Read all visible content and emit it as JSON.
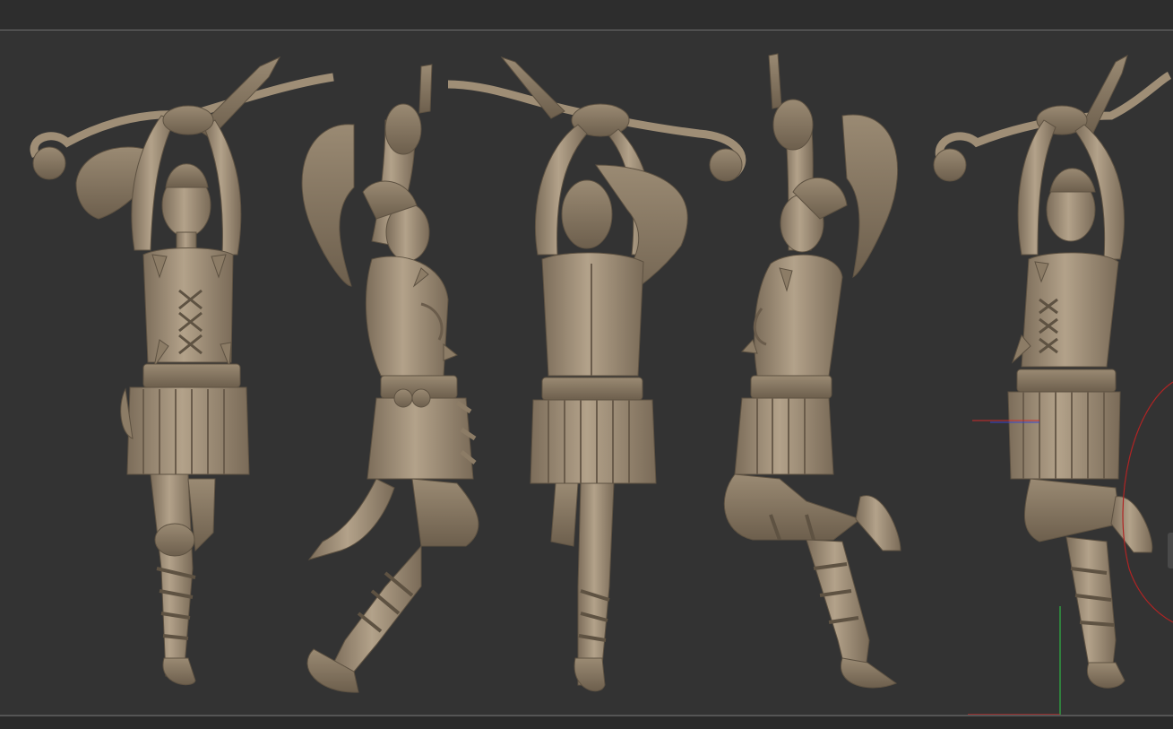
{
  "app": {
    "title": "",
    "viewport_mode": "3d-sculpt-viewport"
  },
  "viewport": {
    "background_color": "#333333",
    "material_color": "#a8977f",
    "material_shadow_color": "#6e604f",
    "axis_colors": {
      "x": "#cc2b2b",
      "y": "#2fb344",
      "z": "#3a46c9"
    },
    "views": [
      {
        "name": "front",
        "icon": "figure-front-icon"
      },
      {
        "name": "left-side",
        "icon": "figure-side-icon"
      },
      {
        "name": "back",
        "icon": "figure-back-icon"
      },
      {
        "name": "right-side",
        "icon": "figure-side-icon"
      },
      {
        "name": "three-quarter",
        "icon": "figure-threequarter-icon"
      }
    ]
  }
}
